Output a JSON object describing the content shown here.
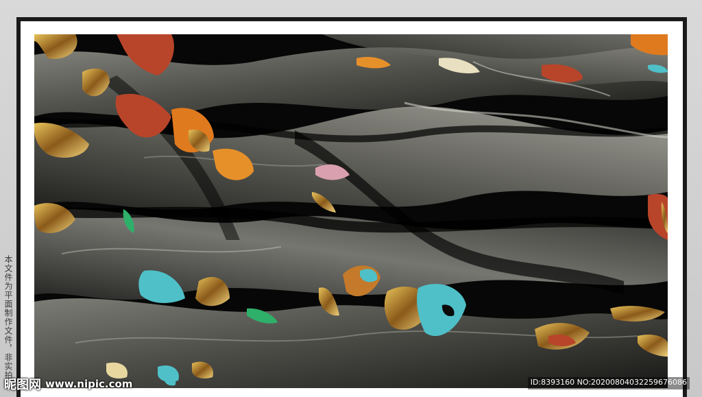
{
  "artwork": {
    "subject": "dark-silver-fabric-abstract",
    "accent_colors": [
      "#c88a2e",
      "#4fc0c8",
      "#2fb06a",
      "#b8452a",
      "#d9a0b0"
    ]
  },
  "side_note": "本文件为平面制作文件，非实拍",
  "watermark": {
    "brand": "昵图网",
    "url": "www.nipic.com",
    "id_text": "ID:8393160 NO:20200804032259676086"
  },
  "colors": {
    "page_bg": "#d0d0d0",
    "frame": "#1a1a1a",
    "mat": "#ffffff",
    "art_bg": "#060606"
  }
}
